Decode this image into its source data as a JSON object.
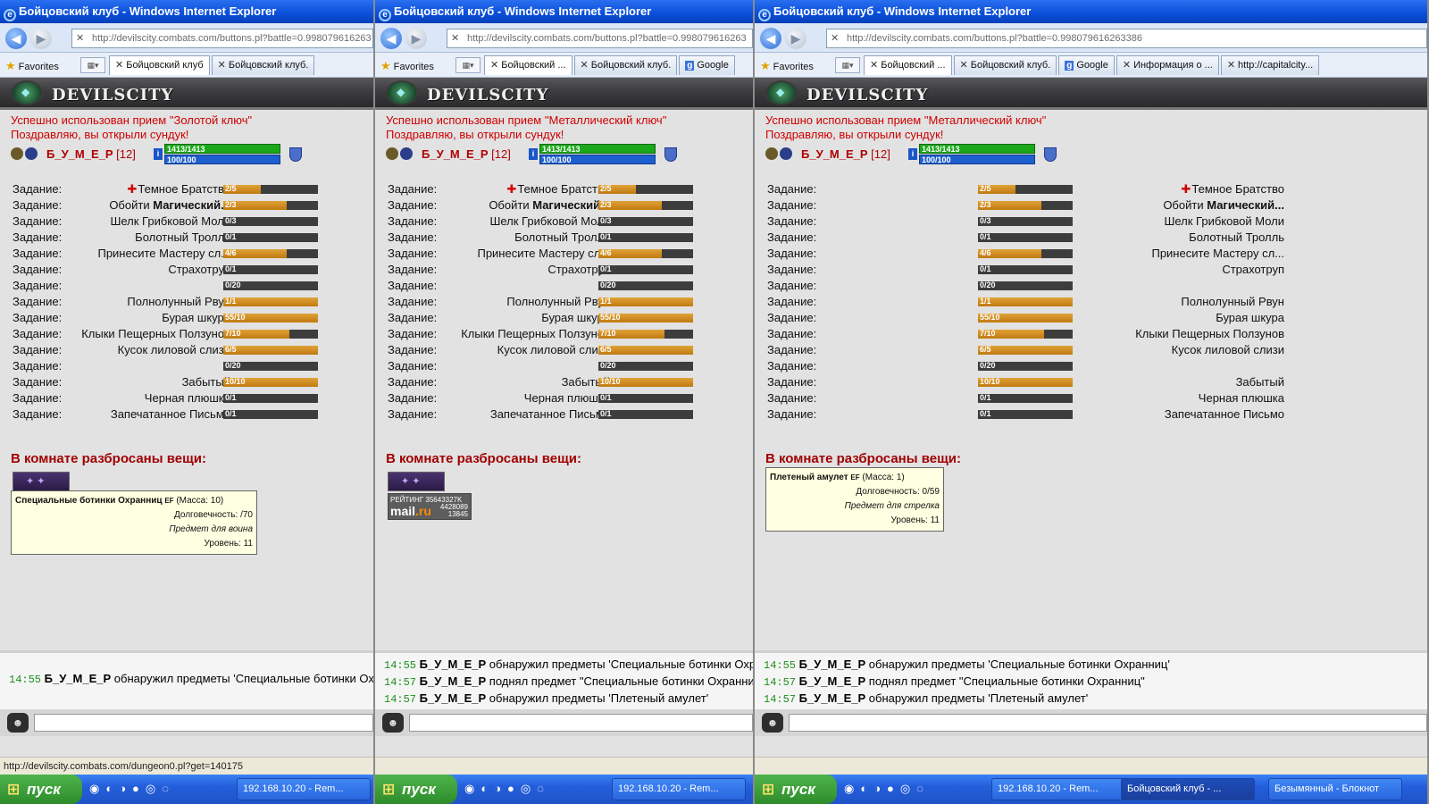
{
  "window_title": "Бойцовский клуб - Windows Internet Explorer",
  "favorites_label": "Favorites",
  "game_logo": "DEVILSCITY",
  "player": {
    "name": "Б_У_М_Е_Р",
    "level": "[12]",
    "hp": "1413/1413",
    "mp": "100/100"
  },
  "quest_label": "Задание:",
  "quests": [
    {
      "name": "Темное Братство",
      "progress": "2/5",
      "ratio": 0.4,
      "cross": true
    },
    {
      "name": "Обойти",
      "bold": "Магический...",
      "progress": "2/3",
      "ratio": 0.67
    },
    {
      "name": "Шелк Грибковой Моли",
      "progress": "0/3",
      "ratio": 0
    },
    {
      "name": "Болотный Тролль",
      "progress": "0/1",
      "ratio": 0
    },
    {
      "name": "Принесите Мастеру сл...",
      "progress": "4/6",
      "ratio": 0.67
    },
    {
      "name": "Страхотруп",
      "progress": "0/1",
      "ratio": 0
    },
    {
      "name": "",
      "progress": "0/20",
      "ratio": 0
    },
    {
      "name": "Полнолунный Рвун",
      "progress": "1/1",
      "ratio": 1
    },
    {
      "name": "Бурая шкура",
      "progress": "55/10",
      "ratio": 1
    },
    {
      "name": "Клыки Пещерных Ползунов",
      "progress": "7/10",
      "ratio": 0.7
    },
    {
      "name": "Кусок лиловой слизи",
      "progress": "6/5",
      "ratio": 1
    },
    {
      "name": "",
      "progress": "0/20",
      "ratio": 0
    },
    {
      "name": "Забытый",
      "progress": "10/10",
      "ratio": 1
    },
    {
      "name": "Черная плюшка",
      "progress": "0/1",
      "ratio": 0
    },
    {
      "name": "Запечатанное Письмо",
      "progress": "0/1",
      "ratio": 0
    }
  ],
  "room_title": "В комнате разбросаны вещи:",
  "panels": [
    {
      "address": "http://devilscity.combats.com/buttons.pl?battle=0.998079616263",
      "tabs": [
        "Бойцовский клуб",
        "Бойцовский клуб."
      ],
      "msg1": "Успешно использован прием \"Золотой ключ\"",
      "msg2": "Поздравляю, вы открыли сундук!",
      "tooltip": {
        "name": "Специальные ботинки Охранниц",
        "mass": "(Масса: 10)",
        "durability": "Долговечность: /70",
        "type": "Предмет для воина",
        "level": "Уровень: 11"
      },
      "chat": [
        {
          "time": "14:55",
          "nick": "Б_У_М_Е_Р",
          "text": "обнаружил предметы 'Специальные ботинки Охранниц'"
        }
      ],
      "status": "http://devilscity.combats.com/dungeon0.pl?get=140175"
    },
    {
      "address": "http://devilscity.combats.com/buttons.pl?battle=0.998079616263",
      "tabs": [
        "Бойцовский ...",
        "Бойцовский клуб.",
        "Google"
      ],
      "msg1": "Успешно использован прием \"Металлический ключ\"",
      "msg2": "Поздравляю, вы открыли сундук!",
      "rating": {
        "label": "РЕЙТИНГ 35643327K",
        "brand_a": "mail",
        "brand_b": ".ru",
        "n1": "4428089",
        "n2": "13845"
      },
      "chat": [
        {
          "time": "14:55",
          "nick": "Б_У_М_Е_Р",
          "text": "обнаружил предметы 'Специальные ботинки Охранниц'"
        },
        {
          "time": "14:57",
          "nick": "Б_У_М_Е_Р",
          "text": "поднял предмет \"Специальные ботинки Охранниц\""
        },
        {
          "time": "14:57",
          "nick": "Б_У_М_Е_Р",
          "text": "обнаружил предметы 'Плетеный амулет'"
        }
      ]
    },
    {
      "address": "http://devilscity.combats.com/buttons.pl?battle=0.998079616263386",
      "tabs": [
        "Бойцовский ...",
        "Бойцовский клуб.",
        "Google",
        "Информация о ...",
        "http://capitalcity..."
      ],
      "msg1": "Успешно использован прием \"Металлический ключ\"",
      "msg2": "Поздравляю, вы открыли сундук!",
      "tooltip": {
        "name": "Плетеный амулет",
        "mass": "(Масса: 1)",
        "durability": "Долговечность: 0/59",
        "type": "Предмет для стрелка",
        "level": "Уровень: 11"
      },
      "chat": [
        {
          "time": "14:55",
          "nick": "Б_У_М_Е_Р",
          "text": "обнаружил предметы 'Специальные ботинки Охранниц'"
        },
        {
          "time": "14:57",
          "nick": "Б_У_М_Е_Р",
          "text": "поднял предмет \"Специальные ботинки Охранниц\""
        },
        {
          "time": "14:57",
          "nick": "Б_У_М_Е_Р",
          "text": "обнаружил предметы 'Плетеный амулет'"
        }
      ]
    }
  ],
  "taskbar": {
    "start": "пуск",
    "tasks": [
      "192.168.10.20 - Rem...",
      "Бойцовский клуб - ...",
      "Безымянный - Блокнот"
    ]
  }
}
